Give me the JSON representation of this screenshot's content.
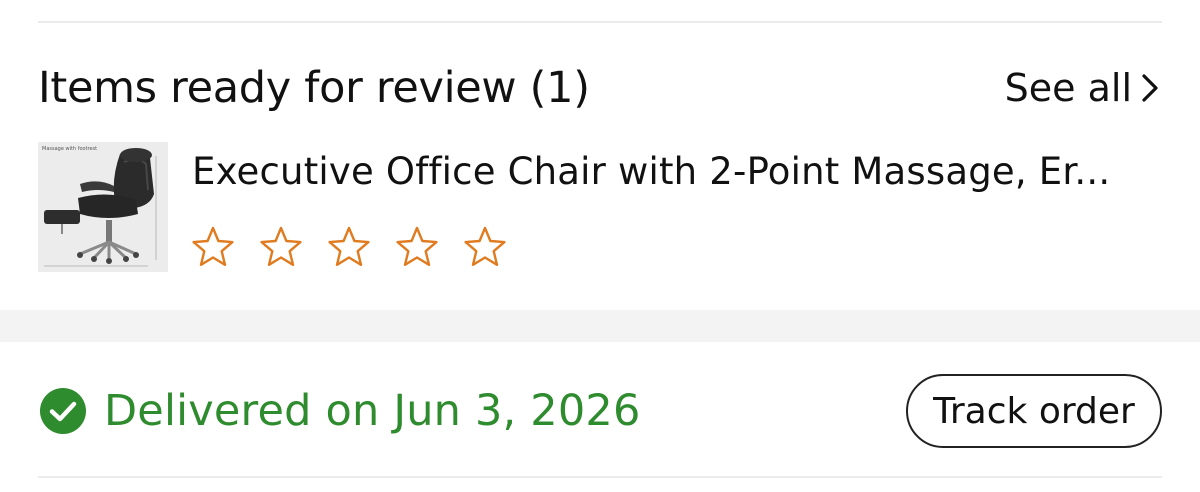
{
  "review": {
    "title": "Items ready for review (1)",
    "see_all_label": "See all",
    "see_all_icon": "chevron-right-icon"
  },
  "product": {
    "thumbnail_alt": "Executive office chair image",
    "thumbnail_caption": "Massage with footrest",
    "title": "Executive Office Chair with 2-Point Massage, Er...",
    "rating": {
      "value": 0,
      "max": 5,
      "star_color": "#e07b20"
    }
  },
  "delivery": {
    "status_icon": "check-circle-icon",
    "status_text": "Delivered on Jun 3, 2026",
    "status_color": "#2e8b2e",
    "track_button_label": "Track order"
  }
}
